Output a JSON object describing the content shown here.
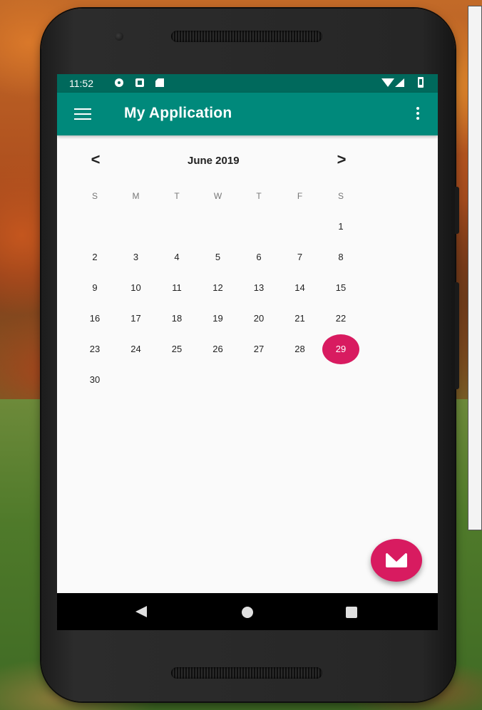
{
  "status_bar": {
    "time": "11:52",
    "icons": [
      "gear-icon",
      "a-icon",
      "sd-card-icon",
      "wifi-icon",
      "signal-icon",
      "battery-icon"
    ]
  },
  "app_bar": {
    "title": "My Application",
    "menu_icon": "hamburger-menu-icon",
    "overflow_icon": "more-vert-icon",
    "background": "#00897b",
    "status_color": "#00695c"
  },
  "calendar": {
    "month_label": "June 2019",
    "prev_symbol": "<",
    "next_symbol": ">",
    "weekdays": [
      "S",
      "M",
      "T",
      "W",
      "T",
      "F",
      "S"
    ],
    "days": [
      "1",
      "2",
      "3",
      "4",
      "5",
      "6",
      "7",
      "8",
      "9",
      "10",
      "11",
      "12",
      "13",
      "14",
      "15",
      "16",
      "17",
      "18",
      "19",
      "20",
      "21",
      "22",
      "23",
      "24",
      "25",
      "26",
      "27",
      "28",
      "29",
      "30"
    ],
    "first_weekday_index": 6,
    "selected_day": "29",
    "selected_color": "#d81b60"
  },
  "fab": {
    "icon": "mail-icon",
    "color": "#d81b60"
  },
  "nav_bar": {
    "buttons": [
      "back-icon",
      "home-icon",
      "recent-apps-icon"
    ]
  }
}
